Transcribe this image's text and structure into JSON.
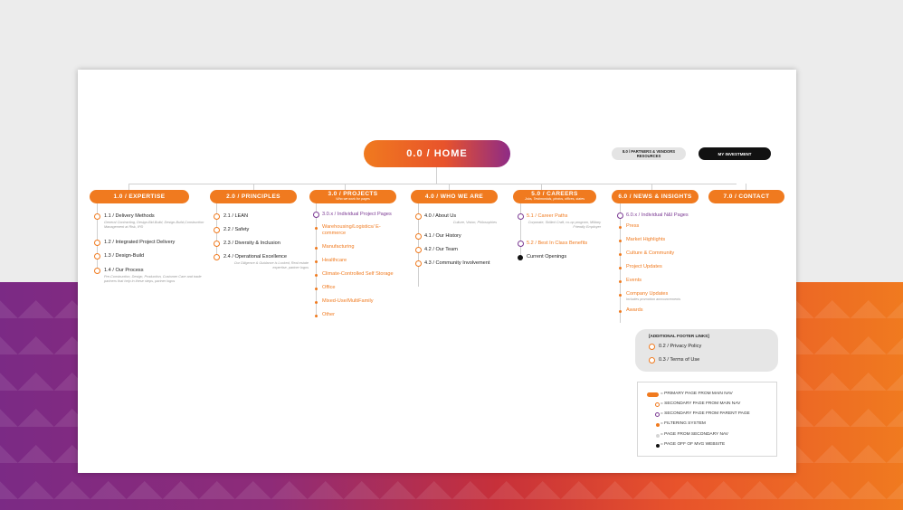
{
  "home": "0.0 / HOME",
  "top_right": {
    "partners_line1": "8.0 / PARTNERS & VENDORS",
    "partners_line2": "RESOURCES",
    "investment": "MY INVESTMENT"
  },
  "nav": [
    {
      "label": "1.0 / EXPERTISE",
      "sub": ""
    },
    {
      "label": "2.0 / PRINCIPLES",
      "sub": ""
    },
    {
      "label": "3.0 / PROJECTS",
      "sub": "Who we work for pages"
    },
    {
      "label": "4.0 / WHO WE ARE",
      "sub": ""
    },
    {
      "label": "5.0 / CAREERS",
      "sub": "Jobs, Testimonials, photos, offices, states"
    },
    {
      "label": "6.0 / NEWS & INSIGHTS",
      "sub": ""
    },
    {
      "label": "7.0 / CONTACT",
      "sub": ""
    }
  ],
  "expertise": [
    {
      "label": "1.1 / Delivery Methods",
      "desc": "General Contracting, Design-Bid-Build, Design-Build,Construction Management at Risk, IPD"
    },
    {
      "label": "1.2 / Integrated Project Delivery",
      "desc": ""
    },
    {
      "label": "1.3 / Design-Build",
      "desc": ""
    },
    {
      "label": "1.4 / Our Process",
      "desc": "Pre-Construction, Design, Production, Customer Care and trade partners that help in these steps, partner logos"
    }
  ],
  "principles": [
    {
      "label": "2.1 / LEAN",
      "desc": ""
    },
    {
      "label": "2.2 / Safety",
      "desc": ""
    },
    {
      "label": "2.3 / Diversity & Inclusion",
      "desc": ""
    },
    {
      "label": "2.4 / Operational Excellence",
      "desc": "Our Diligence & Guidance is Locked, Real estate expertise, partner logos"
    }
  ],
  "projects": {
    "first": "3.0.x / Individual Project Pages",
    "filters": [
      "Warehousing/Logistics/ E-commerce",
      "Manufacturing",
      "Healthcare",
      "Climate-Controlled Self Storage",
      "Office",
      "Mixed-Use/MultiFamily",
      "Other"
    ]
  },
  "who": [
    {
      "label": "4.0 / About Us",
      "desc": "Culture, Vision, Philosophies"
    },
    {
      "label": "4.1 / Our History",
      "desc": ""
    },
    {
      "label": "4.2 / Our Team",
      "desc": ""
    },
    {
      "label": "4.3 / Community Involvement",
      "desc": ""
    }
  ],
  "careers": [
    {
      "label": "5.1 / Career Paths",
      "desc": "Corporate, Skilled Craft, co-op program, Military Friendly Employer"
    },
    {
      "label": "5.2 / Best In Class Benefits",
      "desc": ""
    },
    {
      "label": "Current Openings",
      "desc": ""
    }
  ],
  "news": {
    "first": "6.0.x / Individual N&I Pages",
    "filters": [
      {
        "label": "Press",
        "desc": ""
      },
      {
        "label": "Market Highlights",
        "desc": ""
      },
      {
        "label": "Culture & Community",
        "desc": ""
      },
      {
        "label": "Project Updates",
        "desc": ""
      },
      {
        "label": "Events",
        "desc": ""
      },
      {
        "label": "Company Updates",
        "desc": "Includes promotion announcements"
      },
      {
        "label": "Awards",
        "desc": ""
      }
    ]
  },
  "footer": {
    "title": "[ADDITIONAL FOOTER LINKS]",
    "items": [
      "0.2 / Privacy Policy",
      "0.3 / Terms of Use"
    ]
  },
  "legend": [
    "= PRIMARY PAGE FROM MAIN NAV",
    "= SECONDARY PAGE FROM MAIN NAV",
    "= SECONDARY PAGE FROM PARENT PAGE",
    "= FILTERING SYSTEM",
    "= PAGE FROM SECONDARY NAV",
    "= PAGE OFF OF MVG WEBSITE"
  ],
  "colors": {
    "orange": "#f07a1f",
    "purple": "#7b3a93",
    "black": "#111111"
  }
}
